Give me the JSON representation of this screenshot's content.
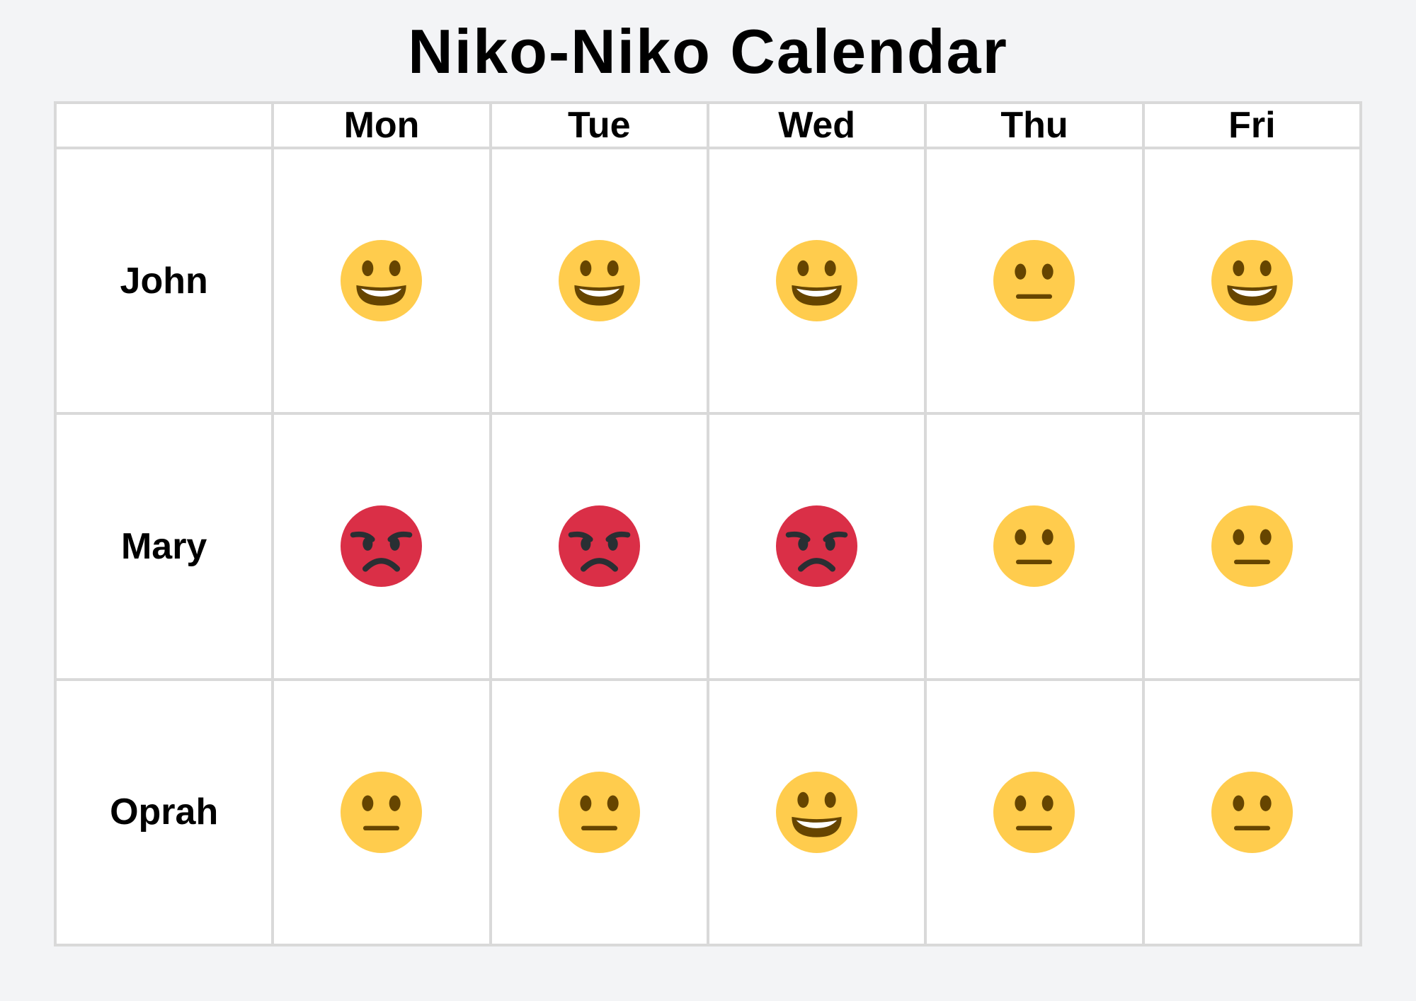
{
  "title": "Niko-Niko Calendar",
  "days": [
    "Mon",
    "Tue",
    "Wed",
    "Thu",
    "Fri"
  ],
  "people": [
    {
      "name": "John",
      "moods": [
        "grinning",
        "grinning",
        "grinning",
        "neutral",
        "grinning"
      ]
    },
    {
      "name": "Mary",
      "moods": [
        "angry",
        "angry",
        "angry",
        "neutral",
        "neutral"
      ]
    },
    {
      "name": "Oprah",
      "moods": [
        "neutral",
        "neutral",
        "grinning",
        "neutral",
        "neutral"
      ]
    }
  ],
  "colors": {
    "yellow": "#ffcc4d",
    "feature": "#664500",
    "red": "#da2f47",
    "dark": "#292f33"
  }
}
